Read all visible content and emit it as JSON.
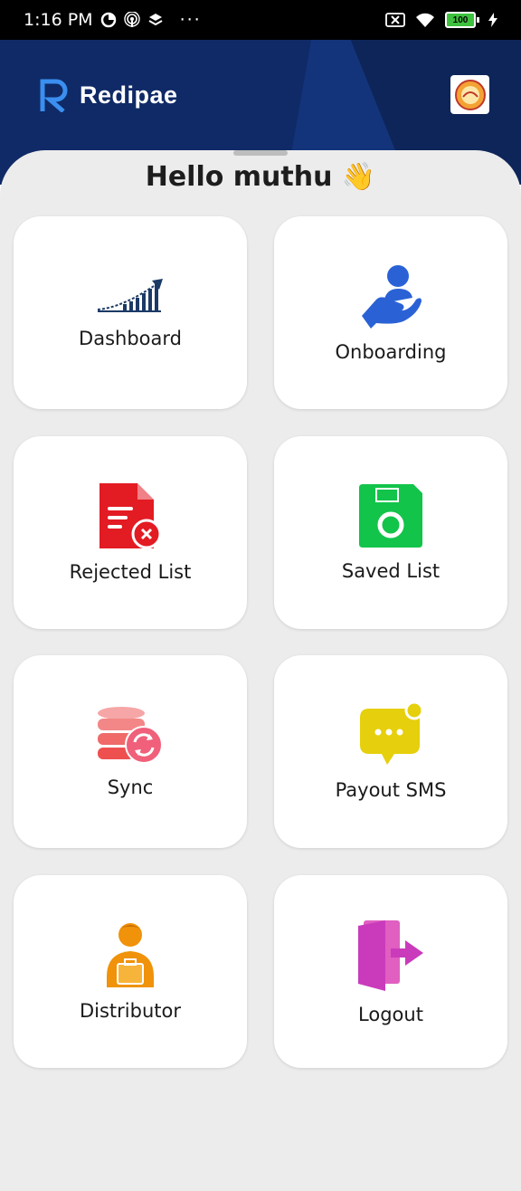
{
  "status_bar": {
    "time": "1:16 PM",
    "more": "···",
    "battery": "100"
  },
  "header": {
    "brand": "Redipae",
    "brand_color": "#0f2a66"
  },
  "greeting": {
    "text": "Hello muthu",
    "emoji": "👋"
  },
  "menu": [
    {
      "label": "Dashboard",
      "icon": "dashboard-chart-icon",
      "color": "#1b3a66"
    },
    {
      "label": "Onboarding",
      "icon": "onboarding-hand-icon",
      "color": "#2a62d6"
    },
    {
      "label": "Rejected List",
      "icon": "rejected-document-icon",
      "color": "#e31b23"
    },
    {
      "label": "Saved List",
      "icon": "floppy-disk-icon",
      "color": "#12c44a"
    },
    {
      "label": "Sync",
      "icon": "database-sync-icon",
      "color": "#f0607a"
    },
    {
      "label": "Payout SMS",
      "icon": "message-bubble-icon",
      "color": "#e6cf0c"
    },
    {
      "label": "Distributor",
      "icon": "distributor-person-icon",
      "color": "#f0920a"
    },
    {
      "label": "Logout",
      "icon": "logout-door-icon",
      "color": "#c93bbb"
    }
  ]
}
